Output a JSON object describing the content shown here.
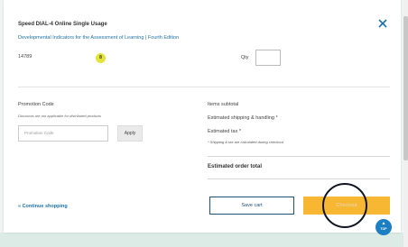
{
  "product": {
    "title": "Speed DIAL-4 Online Single Usage",
    "subtitle": "Developmental Indicators for the Assessment of Learning | Fourth Edition",
    "sku": "14789",
    "badge": "8",
    "qty_label": "Qty",
    "qty_value": ""
  },
  "promo": {
    "label": "Promotion Code",
    "note": "Discounts are not applicable for distributed products",
    "placeholder": "Promotion Code",
    "apply_label": "Apply"
  },
  "summary": {
    "items_subtotal": "Items subtotal",
    "shipping": "Estimated shipping & handling *",
    "tax": "Estimated tax *",
    "note": "* Shipping & tax are calculated during checkout",
    "order_total": "Estimated order total"
  },
  "actions": {
    "continue": "« Continue shopping",
    "save_cart": "Save cart",
    "checkout": "Checkout",
    "top": "TOP"
  },
  "colors": {
    "link": "#1f73a8",
    "checkout": "#f7b733",
    "top_button": "#1c7fc1",
    "badge": "#e2e43a"
  }
}
